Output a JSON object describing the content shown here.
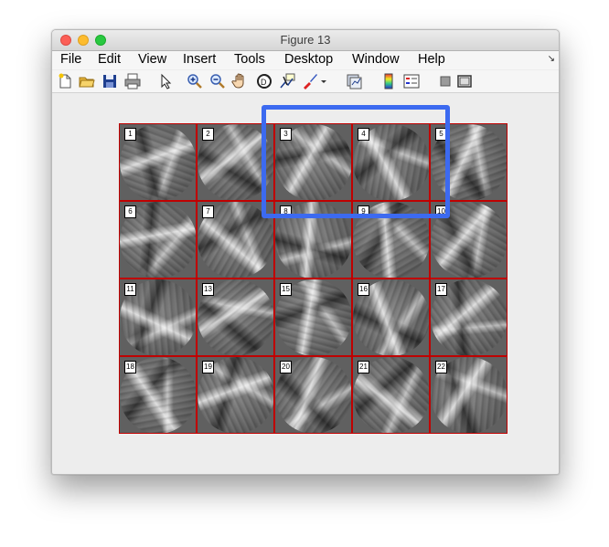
{
  "window": {
    "title": "Figure 13"
  },
  "menu": {
    "items": [
      "File",
      "Edit",
      "View",
      "Insert",
      "Tools",
      "Desktop",
      "Window",
      "Help"
    ]
  },
  "toolbar": {
    "icons": [
      "new-figure-icon",
      "open-icon",
      "save-icon",
      "print-icon",
      "pointer-icon",
      "zoom-in-icon",
      "zoom-out-icon",
      "pan-hand-icon",
      "rotate-3d-icon",
      "data-cursor-icon",
      "brush-icon",
      "brush-dropdown-icon",
      "link-plot-icon",
      "colorbar-icon",
      "legend-icon",
      "hide-plot-tools-icon",
      "show-plot-tools-icon"
    ]
  },
  "montage": {
    "labels": [
      "1",
      "2",
      "3",
      "4",
      "5",
      "6",
      "7",
      "8",
      "9",
      "10",
      "11",
      "13",
      "15",
      "16",
      "17",
      "18",
      "19",
      "20",
      "21",
      "22"
    ]
  },
  "colors": {
    "tile_border": "#c00000",
    "highlight": "#3c6af0"
  }
}
